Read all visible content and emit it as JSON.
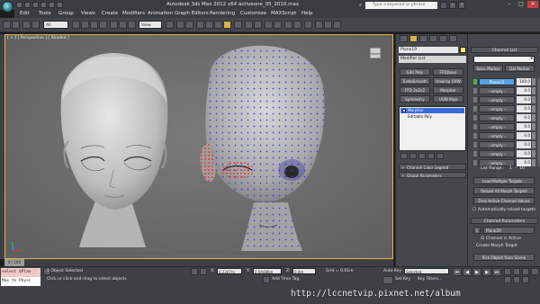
{
  "window": {
    "title": "Autodesk 3ds Max 2012 x64     activeone_05_2010.max",
    "search_placeholder": "Type a keyword or phrase"
  },
  "menu": [
    "Edit",
    "Tools",
    "Group",
    "Views",
    "Create",
    "Modifiers",
    "Animation",
    "Graph Editors",
    "Rendering",
    "Customize",
    "MAXScript",
    "Help"
  ],
  "toolbar": {
    "selection_filter": "All",
    "ref_coord": "View"
  },
  "viewport": {
    "label": "[ + ] [ Perspective ] [ Shaded ]",
    "navcube_label": "FRONT"
  },
  "command_panel": {
    "object_name": "Plane19",
    "modifier_list": "Modifier List",
    "modifier_buttons": [
      [
        "Edit Poly",
        "FFD(box)"
      ],
      [
        "TurboSmooth",
        "Unwrap UVW"
      ],
      [
        "FFD 2x2x2",
        "Morpher"
      ],
      [
        "Symmetry",
        "UVW Map"
      ]
    ],
    "stack": [
      "Morpher",
      "Editable Poly"
    ],
    "rollouts": [
      "Channel Color Legend",
      "Global Parameters"
    ]
  },
  "channel_panel": {
    "header": "Channel List",
    "save_marker": "Save Marker",
    "del_marker": "Del Marker",
    "channels": [
      {
        "name": "Plane20",
        "value": "100.0",
        "active": true
      },
      {
        "name": "- empty -",
        "value": "0.0",
        "active": false
      },
      {
        "name": "- empty -",
        "value": "0.0",
        "active": false
      },
      {
        "name": "- empty -",
        "value": "0.0",
        "active": false
      },
      {
        "name": "- empty -",
        "value": "0.0",
        "active": false
      },
      {
        "name": "- empty -",
        "value": "0.0",
        "active": false
      },
      {
        "name": "- empty -",
        "value": "0.0",
        "active": false
      },
      {
        "name": "- empty -",
        "value": "0.0",
        "active": false
      },
      {
        "name": "- empty -",
        "value": "0.0",
        "active": false
      },
      {
        "name": "- empty -",
        "value": "0.0",
        "active": false
      }
    ],
    "list_range": "List Range :",
    "range_from": "1",
    "range_to": "10",
    "load_multiple": "Load Multiple Targets...",
    "reload_all": "Reload All Morph Targets",
    "zero_active": "Zero Active Channel Values",
    "auto_reload": "Automatically reload targets",
    "params_header": "Channel Parameters",
    "param_index": "1",
    "param_name": "Plane20",
    "channel_active": "Channel is Active",
    "create_morph": "Create Morph Target",
    "pick_object": "Pick Object from Scene"
  },
  "timeline": {
    "frame": "0 / 100"
  },
  "status": {
    "script_line1": "select $Plan",
    "script_line2": "Max to Physc",
    "selected": "1 Object Selected",
    "prompt": "Click or click-and-drag to select objects",
    "x": "0.2207m",
    "y": "0.04486m",
    "z": "0.0m",
    "grid": "Grid = 0.01m",
    "auto_key": "Auto Key",
    "auto_key_value": "Selected",
    "set_key": "Set Key",
    "key_filters": "Key Filters...",
    "add_time_tag": "Add Time Tag"
  },
  "watermark": "http://lccnetvip.pixnet.net/album"
}
